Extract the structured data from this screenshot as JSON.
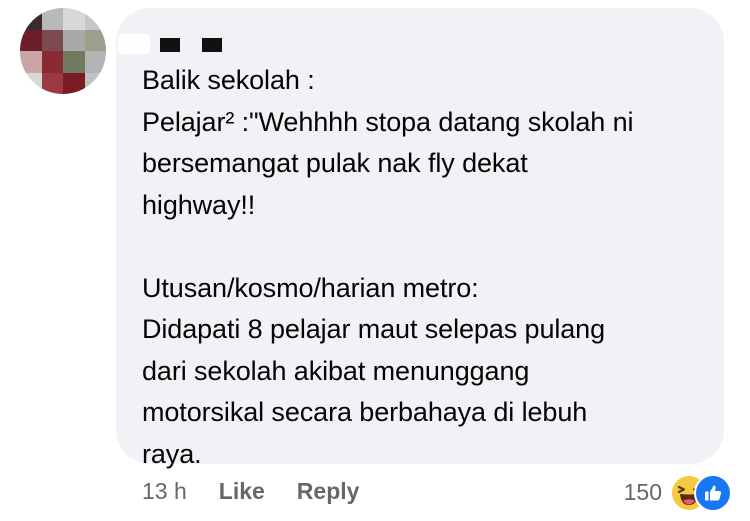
{
  "comment": {
    "lines": [
      "Balik sekolah :",
      "Pelajar² :\"Wehhhh stopa datang skolah ni",
      "bersemangat pulak nak fly dekat",
      "highway!!",
      "",
      "Utusan/kosmo/harian metro:",
      "Didapati 8 pelajar maut selepas pulang",
      "dari sekolah akibat menunggang",
      "motorsikal secara berbahaya di lebuh",
      "raya."
    ]
  },
  "meta": {
    "time": "13 h",
    "like_label": "Like",
    "reply_label": "Reply"
  },
  "reactions": {
    "count": "150",
    "types": [
      "haha",
      "like"
    ]
  },
  "colors": {
    "bubble": "#f0f2f5",
    "text": "#050505",
    "meta_text": "#65676b",
    "like_blue": "#1877f2",
    "haha_yellow": "#f7c842"
  }
}
